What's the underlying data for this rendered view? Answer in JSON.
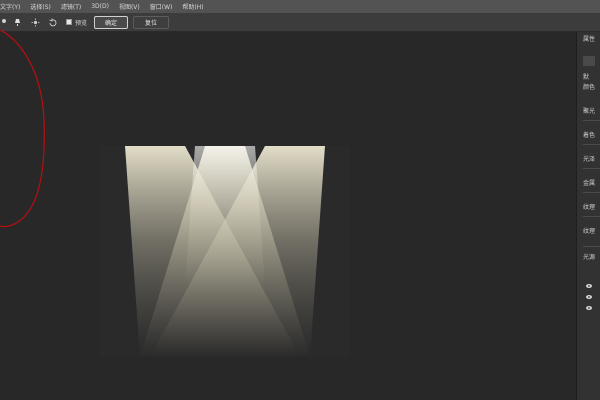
{
  "menubar": {
    "items": [
      "文字(Y)",
      "选择(S)",
      "滤镜(T)",
      "3D(D)",
      "视图(V)",
      "窗口(W)",
      "帮助(H)"
    ]
  },
  "options": {
    "checkbox_label": "预览",
    "ok_label": "确定",
    "reset_label": "复位"
  },
  "panel": {
    "labels": [
      "属性",
      "默",
      "颜色",
      "聚光",
      "着色",
      "光泽",
      "金属",
      "纹理",
      "纹理",
      "光源"
    ]
  },
  "colors": {
    "annotation": "#b01010",
    "spotlight": "#e8e3cc"
  }
}
